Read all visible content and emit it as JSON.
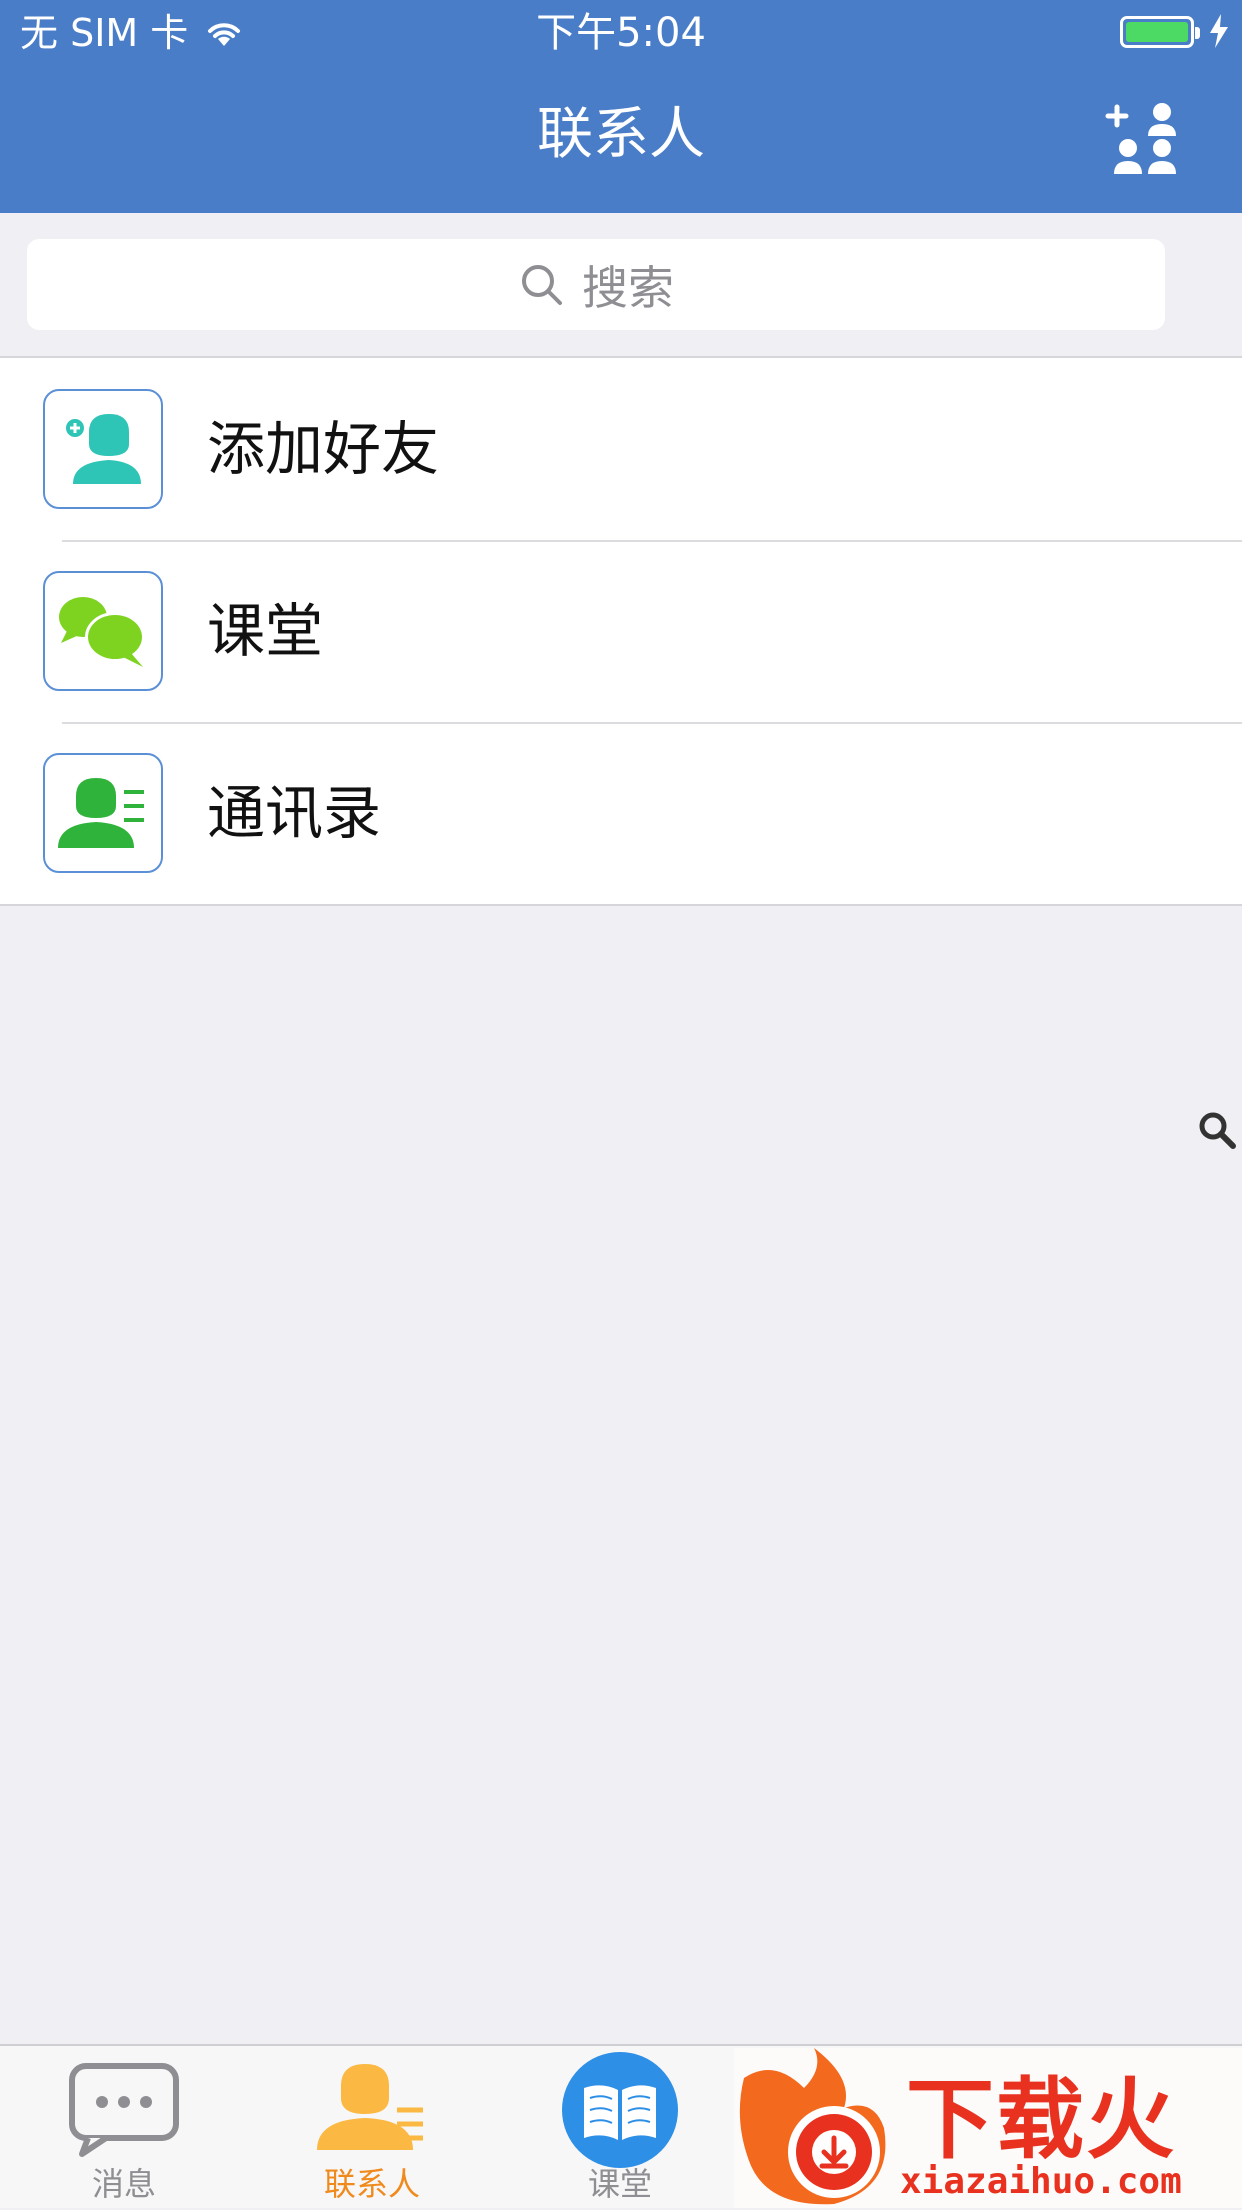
{
  "status_bar": {
    "carrier": "无 SIM 卡",
    "time": "下午5:04"
  },
  "nav": {
    "title": "联系人",
    "right_icon": "add-contacts-icon"
  },
  "search": {
    "placeholder": "搜索"
  },
  "list": {
    "items": [
      {
        "label": "添加好友",
        "icon": "add-friend-icon",
        "color": "#2ec4b6"
      },
      {
        "label": "课堂",
        "icon": "chat-bubbles-icon",
        "color": "#7ed321"
      },
      {
        "label": "通讯录",
        "icon": "address-book-icon",
        "color": "#3ab54a"
      }
    ]
  },
  "tabbar": {
    "tabs": [
      {
        "label": "消息",
        "icon": "message-icon",
        "active": false
      },
      {
        "label": "联系人",
        "icon": "contacts-icon",
        "active": true
      },
      {
        "label": "课堂",
        "icon": "book-icon",
        "active": false
      }
    ]
  },
  "watermark": {
    "brand": "下载火",
    "url": "xiazaihuo.com"
  },
  "colors": {
    "header": "#4a7dc8",
    "active_tab": "#f08a1c",
    "battery": "#4cd964",
    "watermark": "#e8321f"
  }
}
